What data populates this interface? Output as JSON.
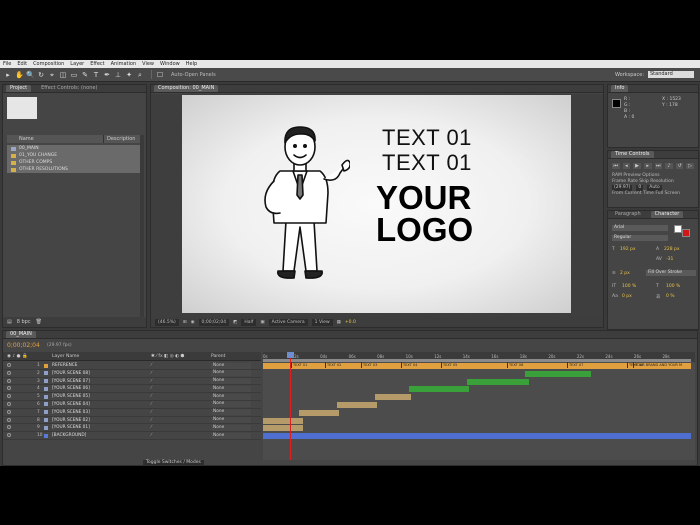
{
  "menu": [
    "File",
    "Edit",
    "Composition",
    "Layer",
    "Effect",
    "Animation",
    "View",
    "Window",
    "Help"
  ],
  "toolbar": {
    "tools": [
      "▸",
      "✋",
      "🔍",
      "↻",
      "⌖",
      "◫",
      "▭",
      "✎",
      "T",
      "✒",
      "⊥",
      "✦",
      "⌕"
    ],
    "auto_open": "Auto-Open Panels",
    "workspace_label": "Workspace:",
    "workspace_value": "Standard"
  },
  "project": {
    "tabs": [
      "Project",
      "Effect Controls: (none)"
    ],
    "col_name": "Name",
    "col_desc": "Description",
    "items": [
      {
        "label": "00_MAIN",
        "kind": "comp",
        "selected": true
      },
      {
        "label": "01_YOU CHANGE",
        "kind": "folder",
        "selected": true
      },
      {
        "label": "OTHER COMPS",
        "kind": "folder",
        "selected": true
      },
      {
        "label": "OTHER RESOLUTIONS",
        "kind": "folder",
        "selected": true
      }
    ],
    "footer_bpc": "8 bpc"
  },
  "composition": {
    "tab": "Composition: 00_MAIN",
    "line1": "TEXT 01",
    "line2": "TEXT 01",
    "logo_line1": "YOUR",
    "logo_line2": "LOGO",
    "zoom": "(46.5%)",
    "timecode": "0;00;02;04",
    "resolution": "Half",
    "camera": "Active Camera",
    "views": "1 View",
    "exposure": "+0.0"
  },
  "info": {
    "tab": "Info",
    "rgb": [
      "R :",
      "G :",
      "B :",
      "A : 0"
    ],
    "coords": [
      "X : 1523",
      "Y : 178"
    ]
  },
  "time_controls": {
    "tab": "Time Controls",
    "ram_preview": "RAM Preview Options",
    "frame_rate_label": "Frame Rate",
    "skip_label": "Skip",
    "resolution_label": "Resolution",
    "frame_rate": "(29.97)",
    "skip": "0",
    "resolution": "Auto",
    "from_current": "From Current Time",
    "full_screen": "Full Screen"
  },
  "paragraph": {
    "tabs": [
      "Paragraph",
      "Character"
    ],
    "font": "Arial",
    "style": "Regular",
    "size": "192 px",
    "leading": "228 px",
    "tracking": "-31",
    "stroke": "2 px",
    "stroke_mode": "Fill Over Stroke",
    "vscale": "100 %",
    "hscale": "100 %",
    "baseline": "0 px",
    "tsume": "0 %"
  },
  "timeline": {
    "tab": "00_MAIN",
    "time": "0;00;02;04",
    "fps": "(29.97 fps)",
    "header": {
      "layer_name": "Layer Name",
      "parent": "Parent"
    },
    "toggle": "Toggle Switches / Modes",
    "ruler": [
      "0s",
      "02s",
      "04s",
      "06s",
      "08s",
      "10s",
      "12s",
      "14s",
      "16s",
      "18s",
      "20s",
      "22s",
      "24s",
      "26s",
      "28s"
    ],
    "layers": [
      {
        "num": "1",
        "name": "REFERENCE",
        "color": "#e0a040",
        "parent": "None"
      },
      {
        "num": "2",
        "name": "[YOUR SCENE 08]",
        "color": "#8fa0c8",
        "parent": "None"
      },
      {
        "num": "3",
        "name": "[YOUR SCENE 07]",
        "color": "#8fa0c8",
        "parent": "None"
      },
      {
        "num": "4",
        "name": "[YOUR SCENE 06]",
        "color": "#8fa0c8",
        "parent": "None"
      },
      {
        "num": "5",
        "name": "[YOUR SCENE 05]",
        "color": "#8fa0c8",
        "parent": "None"
      },
      {
        "num": "6",
        "name": "[YOUR SCENE 04]",
        "color": "#8fa0c8",
        "parent": "None"
      },
      {
        "num": "7",
        "name": "[YOUR SCENE 03]",
        "color": "#8fa0c8",
        "parent": "None"
      },
      {
        "num": "8",
        "name": "[YOUR SCENE 02]",
        "color": "#8fa0c8",
        "parent": "None"
      },
      {
        "num": "9",
        "name": "[YOUR SCENE 01]",
        "color": "#8fa0c8",
        "parent": "None"
      },
      {
        "num": "10",
        "name": "[BACKGROUND]",
        "color": "#5a7ad8",
        "parent": "None"
      }
    ],
    "markers": [
      "TEXT 01",
      "TEXT 02",
      "TEXT 03",
      "TEXT 04",
      "TEXT 05",
      "TEXT 06",
      "TEXT 07",
      "TEXT 08",
      "YOUR BRAND AND YOUR M"
    ],
    "colors": {
      "reference": "#e0a040",
      "green": "#3aa03a",
      "tan": "#b59a6a",
      "background": "#4f6fd0"
    }
  }
}
